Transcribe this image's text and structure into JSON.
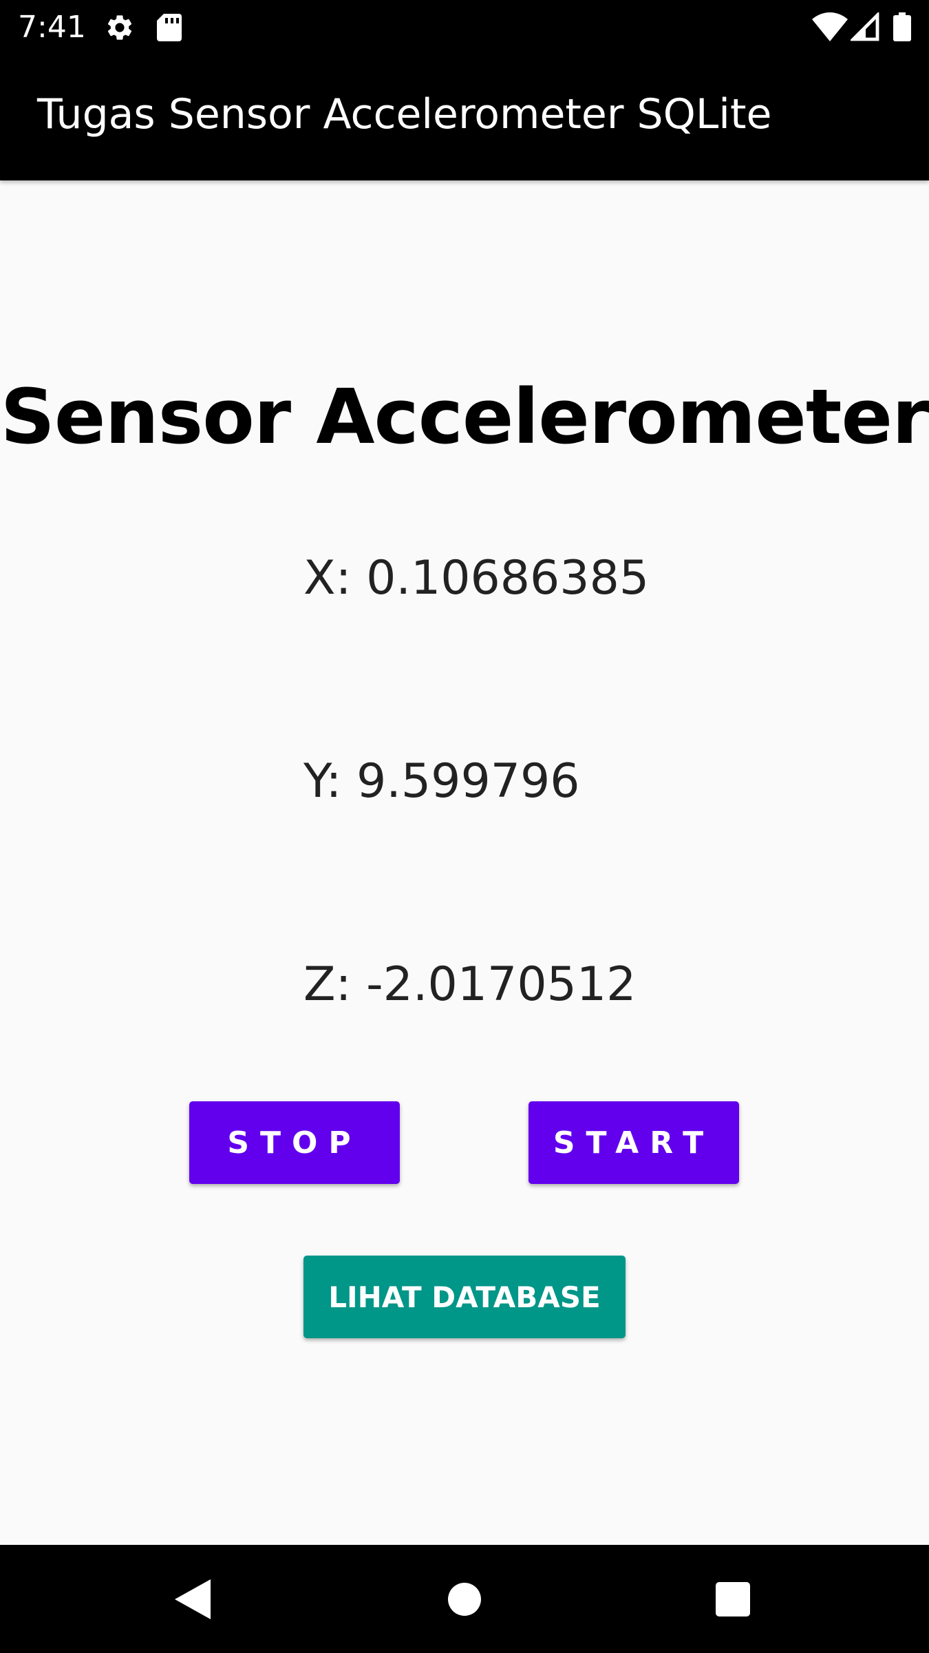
{
  "status_bar": {
    "time": "7:41",
    "icons": [
      "gear-icon",
      "sd-card-icon",
      "wifi-icon",
      "signal-icon",
      "battery-icon"
    ]
  },
  "app_bar": {
    "title": "Tugas Sensor Accelerometer SQLite"
  },
  "main": {
    "heading": "Sensor Accelerometer",
    "x_reading": "X: 0.10686385",
    "y_reading": "Y: 9.599796",
    "z_reading": "Z: -2.0170512",
    "stop_label": "STOP",
    "start_label": "START",
    "database_label": "LIHAT DATABASE"
  },
  "nav_bar": {
    "icons": [
      "back-icon",
      "home-icon",
      "recents-icon"
    ]
  },
  "colors": {
    "primary_button": "#6200ee",
    "secondary_button": "#009688",
    "bars": "#000000",
    "background": "#fafafa"
  }
}
